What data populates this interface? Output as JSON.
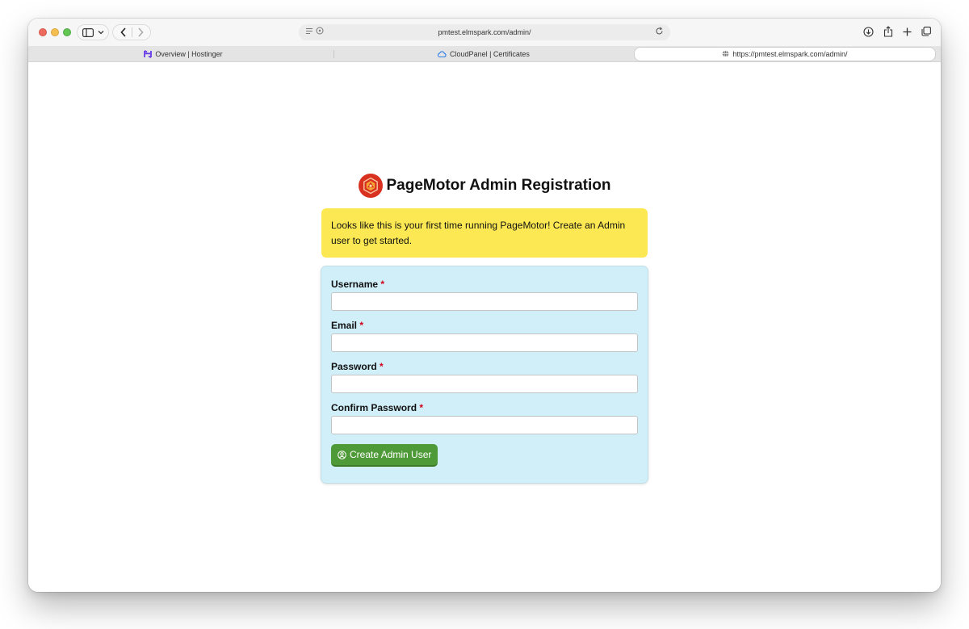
{
  "browser": {
    "url": "pmtest.elmspark.com/admin/",
    "tabs": [
      {
        "label": "Overview | Hostinger",
        "icon": "hostinger-icon",
        "icon_color": "#673de6",
        "active": false
      },
      {
        "label": "CloudPanel | Certificates",
        "icon": "cloudpanel-icon",
        "icon_color": "#2f7ee8",
        "active": false
      },
      {
        "label": "https://pmtest.elmspark.com/admin/",
        "icon": "globe-icon",
        "icon_color": "#666666",
        "active": true
      }
    ]
  },
  "page": {
    "title": "PageMotor Admin Registration",
    "logo_color": "#d9311f",
    "alert": "Looks like this is your first time running PageMotor! Create an Admin user to get started.",
    "alert_color": "#fbe852",
    "form_bg": "#d0eff8",
    "fields": [
      {
        "label": "Username",
        "required": "*",
        "value": ""
      },
      {
        "label": "Email",
        "required": "*",
        "value": ""
      },
      {
        "label": "Password",
        "required": "*",
        "value": ""
      },
      {
        "label": "Confirm Password",
        "required": "*",
        "value": ""
      }
    ],
    "submit_label": "Create Admin User",
    "submit_color": "#4f9a38"
  }
}
